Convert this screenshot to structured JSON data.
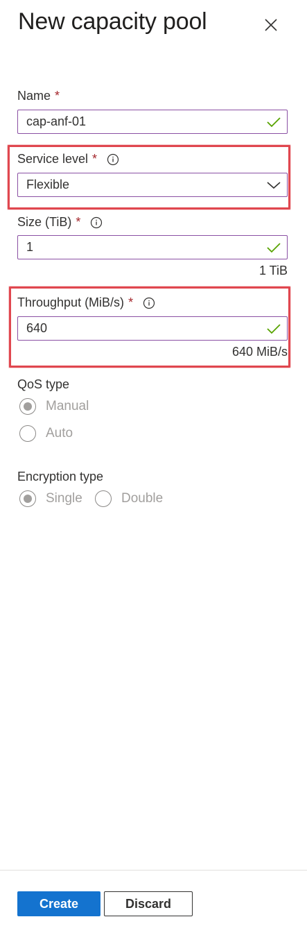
{
  "panel": {
    "title": "New capacity pool"
  },
  "name": {
    "label": "Name",
    "required_mark": "*",
    "value": "cap-anf-01"
  },
  "service_level": {
    "label": "Service level",
    "required_mark": "*",
    "value": "Flexible"
  },
  "size": {
    "label": "Size (TiB)",
    "required_mark": "*",
    "value": "1",
    "hint": "1 TiB"
  },
  "throughput": {
    "label": "Throughput (MiB/s)",
    "required_mark": "*",
    "value": "640",
    "hint": "640 MiB/s"
  },
  "qos": {
    "label": "QoS type",
    "options": [
      "Manual",
      "Auto"
    ],
    "selected": "Manual"
  },
  "encryption": {
    "label": "Encryption type",
    "options": [
      "Single",
      "Double"
    ],
    "selected": "Single"
  },
  "footer": {
    "create_label": "Create",
    "discard_label": "Discard"
  },
  "colors": {
    "accent": "#1473cf",
    "highlight": "#e0474f",
    "required": "#a4262c",
    "valid": "#57a300",
    "input_border": "#8a4fa3"
  },
  "icons": {
    "close": "close-icon",
    "info": "info-icon",
    "valid": "checkmark-icon",
    "dropdown": "chevron-down-icon"
  }
}
